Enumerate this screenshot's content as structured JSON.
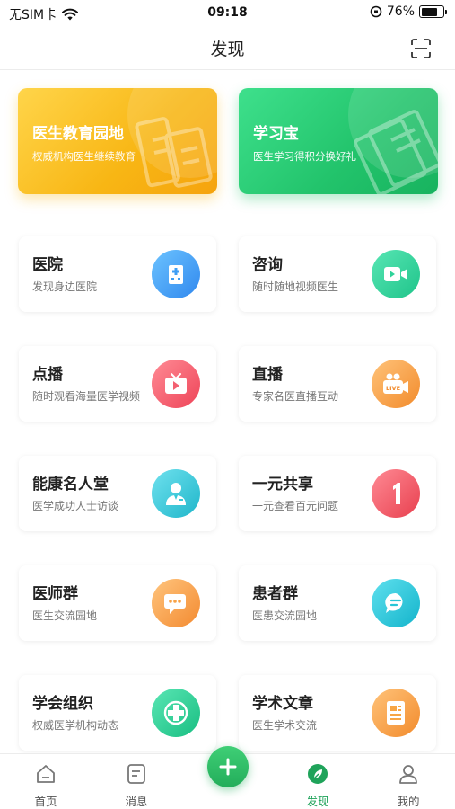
{
  "status": {
    "carrier": "无SIM卡",
    "time": "09:18",
    "battery": "76%",
    "battery_level": 0.76
  },
  "nav": {
    "title": "发现",
    "scan_icon": "scan-icon"
  },
  "banners": [
    {
      "title": "医生教育园地",
      "subtitle": "权威机构医生继续教育",
      "icon": "building-icon"
    },
    {
      "title": "学习宝",
      "subtitle": "医生学习得积分换好礼",
      "icon": "books-icon"
    }
  ],
  "cards": [
    {
      "title": "医院",
      "subtitle": "发现身边医院",
      "icon": "hospital-icon",
      "color": "#3f9ef4"
    },
    {
      "title": "咨询",
      "subtitle": "随时随地视频医生",
      "icon": "video-call-icon",
      "color": "#2fd39a"
    },
    {
      "title": "点播",
      "subtitle": "随时观看海量医学视频",
      "icon": "tv-icon",
      "color": "#f36070"
    },
    {
      "title": "直播",
      "subtitle": "专家名医直播互动",
      "icon": "live-camera-icon",
      "color": "#f7a544"
    },
    {
      "title": "能康名人堂",
      "subtitle": "医学成功人士访谈",
      "icon": "doctor-icon",
      "color": "#35c9d8"
    },
    {
      "title": "一元共享",
      "subtitle": "一元查看百元问题",
      "icon": "one-icon",
      "color": "#f35b67"
    },
    {
      "title": "医师群",
      "subtitle": "医生交流园地",
      "icon": "chat-bubble-icon",
      "color": "#f8a247"
    },
    {
      "title": "患者群",
      "subtitle": "医患交流园地",
      "icon": "message-icon",
      "color": "#27c6d6"
    },
    {
      "title": "学会组织",
      "subtitle": "权威医学机构动态",
      "icon": "medical-cross-icon",
      "color": "#2fd39a"
    },
    {
      "title": "学术文章",
      "subtitle": "医生学术交流",
      "icon": "article-icon",
      "color": "#f7a544"
    }
  ],
  "tabs": [
    {
      "label": "首页",
      "icon": "home-icon"
    },
    {
      "label": "消息",
      "icon": "message-list-icon"
    },
    {
      "label": "发现",
      "icon": "leaf-icon",
      "active": true
    },
    {
      "label": "我的",
      "icon": "profile-icon"
    }
  ],
  "colors": {
    "accent": "#23ad5a",
    "banner_orange": "#f8b614",
    "banner_green": "#22c36b"
  }
}
